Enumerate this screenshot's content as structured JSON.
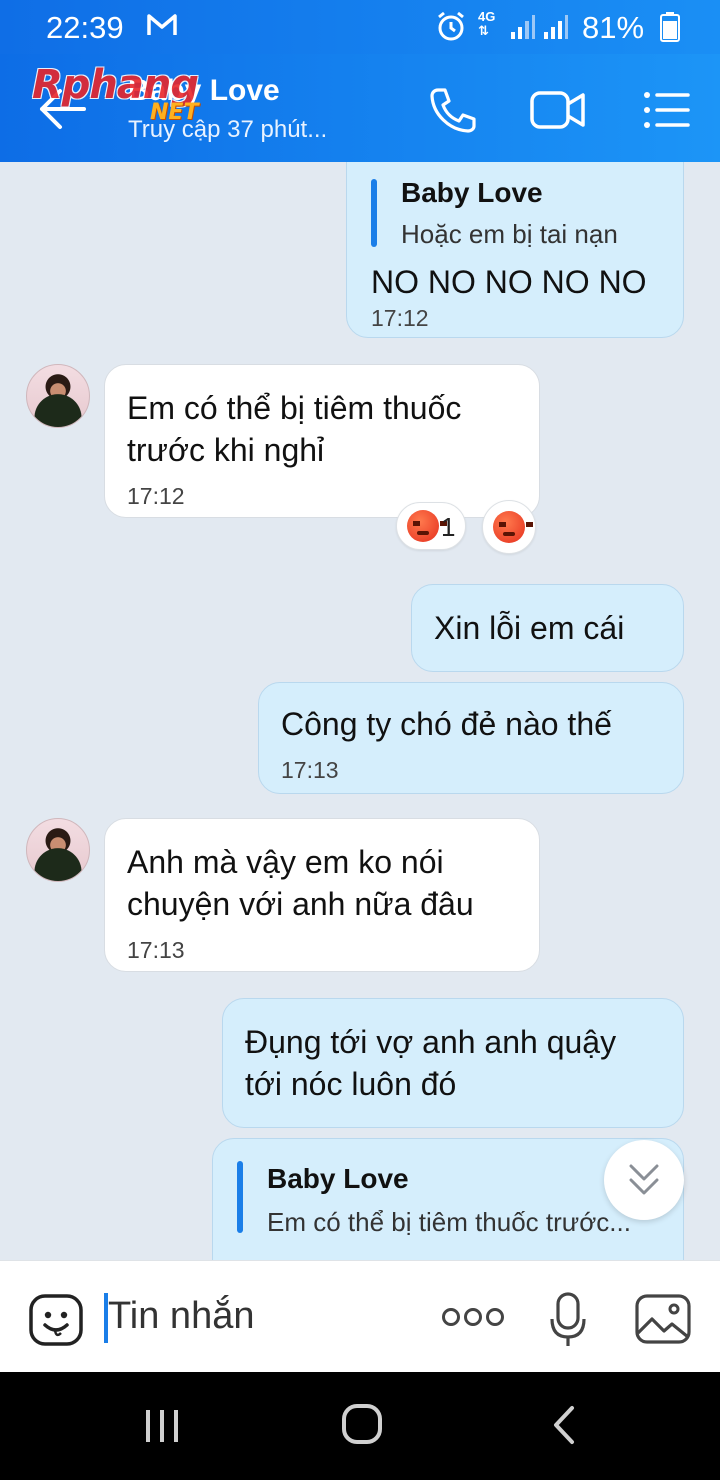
{
  "status_bar": {
    "time": "22:39",
    "network": "4G",
    "battery": "81%"
  },
  "header": {
    "title": "Baby Love",
    "subtitle": "Truy cập 37 phút...",
    "watermark": "Rphang",
    "watermark_suffix": "NET"
  },
  "messages": [
    {
      "direction": "out",
      "quote_name": "Baby Love",
      "quote_text": "Hoặc em bị tai nạn",
      "lines": [
        "NO NO NO NO NO"
      ],
      "time": "17:12"
    },
    {
      "direction": "in",
      "lines": [
        "Em có thể bị tiêm thuốc",
        "trước khi nghỉ"
      ],
      "time": "17:12",
      "reaction_count": "1"
    },
    {
      "direction": "out",
      "lines": [
        "Xin lỗi em cái"
      ],
      "time": ""
    },
    {
      "direction": "out",
      "lines": [
        "Công ty chó đẻ nào thế"
      ],
      "time": "17:13"
    },
    {
      "direction": "in",
      "lines": [
        "Anh mà vậy em ko nói",
        "chuyện với anh nữa đâu"
      ],
      "time": "17:13"
    },
    {
      "direction": "out",
      "lines": [
        "Đụng tới vợ anh anh quậy",
        "tới nóc luôn đó"
      ],
      "time": ""
    },
    {
      "direction": "out",
      "quote_name": "Baby Love",
      "quote_text": "Em có thể bị tiêm thuốc trước...",
      "lines": [],
      "time": ""
    }
  ],
  "input": {
    "placeholder": "Tin nhắn"
  },
  "icons": {
    "back": "arrow-left-icon",
    "call": "phone-icon",
    "video": "video-camera-icon",
    "menu": "list-menu-icon",
    "emoji": "sticker-icon",
    "more": "more-dots-icon",
    "mic": "microphone-icon",
    "gallery": "image-icon",
    "scroll": "chevron-double-down-icon"
  },
  "colors": {
    "header": "#1a8ff5",
    "outgoing_bubble": "#d5eefc",
    "incoming_bubble": "#ffffff",
    "quote_bar": "#1a7ee8",
    "chat_background": "#e2e9f1"
  }
}
